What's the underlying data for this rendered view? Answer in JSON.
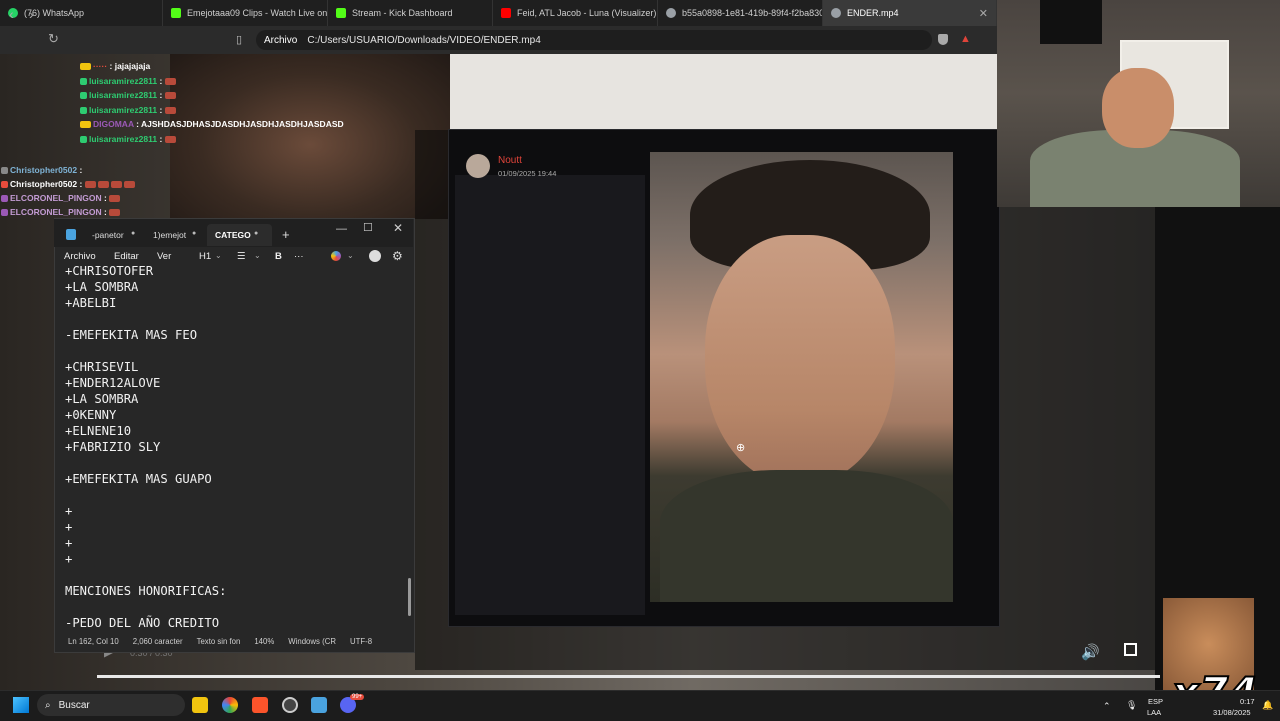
{
  "browser": {
    "tabs": [
      {
        "label": "(76) WhatsApp",
        "color": "#25d366"
      },
      {
        "label": "Emejotaaa09 Clips - Watch Live on K",
        "color": "#53fc18"
      },
      {
        "label": "Stream - Kick Dashboard",
        "color": "#53fc18"
      },
      {
        "label": "Feid, ATL Jacob - Luna (Visualizer) - Y",
        "color": "#ff0000"
      },
      {
        "label": "b55a0898-1e81-419b-89f4-f2ba830c",
        "color": "#9aa0a6"
      },
      {
        "label": "ENDER.mp4",
        "color": "#9aa0a6"
      }
    ],
    "address_chip": "Archivo",
    "url": "C:/Users/USUARIO/Downloads/VIDEO/ENDER.mp4"
  },
  "chat": {
    "lines": [
      {
        "user": "luisaramirez2811",
        "msg": ":"
      },
      {
        "user": "luisaramirez2811",
        "msg": ":"
      },
      {
        "user": "DIGOMAA",
        "msg": ": AJSHDASJDHASJDASDHJASDHJASDHJASDASD"
      },
      {
        "user": "luisaramirez2811",
        "msg": ":"
      },
      {
        "user": "luisaramirez2811",
        "msg": ":"
      },
      {
        "user": "Christopher0502",
        "msg": ":"
      },
      {
        "user": "Christopher0502",
        "msg": ":"
      },
      {
        "user": "ELCORONEL_PINGON",
        "msg": ":"
      },
      {
        "user": "ELCORONEL_PINGON",
        "msg": ":"
      }
    ],
    "top_msg": ": jajajajaja"
  },
  "discord": {
    "author": "Noutt",
    "timestamp": "01/09/2025 19:44"
  },
  "notepad": {
    "tabs": [
      "-panetor",
      "1)emejot",
      "CATEGO"
    ],
    "menu": [
      "Archivo",
      "Editar",
      "Ver"
    ],
    "heading": "H1",
    "bold": "B",
    "more": "···",
    "content": "+CHRISOTOFER\n+LA SOMBRA\n+ABELBI\n\n-EMEFEKITA MAS FEO\n\n+CHRISEVIL\n+ENDER12ALOVE\n+LA SOMBRA\n+0KENNY\n+ELNENE10\n+FABRIZIO SLY\n\n+EMEFEKITA MAS GUAPO\n\n+\n+\n+\n+\n\nMENCIONES HONORIFICAS:\n\n-PEDO DEL AÑO CREDITO",
    "status": [
      "Ln 162, Col 10",
      "2,060 caracter",
      "Texto sin fon",
      "140%",
      "Windows (CR",
      "UTF-8"
    ]
  },
  "player": {
    "time": "0:30 / 0:30"
  },
  "taskbar": {
    "search": "Buscar",
    "lang_top": "ESP",
    "lang_bottom": "LAA",
    "time": "0:17",
    "date": "31/08/2025",
    "badge": "99+"
  },
  "overlay_text": "x74"
}
